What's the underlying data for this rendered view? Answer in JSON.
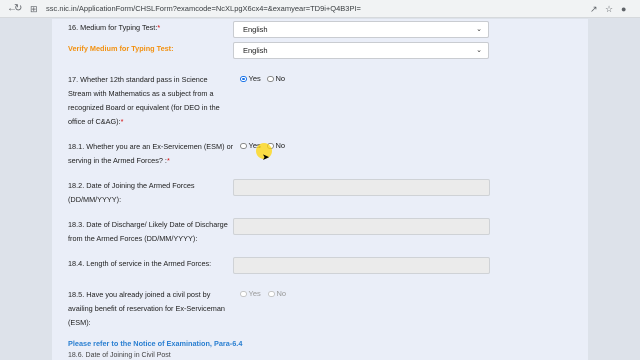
{
  "browser": {
    "url": "ssc.nic.in/ApplicationForm/CHSLForm?examcode=NcXLpgX6cx4=&examyear=TD9i+Q4B3PI=",
    "icons": [
      "back-icon",
      "reload-icon",
      "site-info-icon",
      "share-icon",
      "bookmark-star-icon",
      "profile-icon"
    ]
  },
  "form": {
    "q16": {
      "label": "16. Medium for Typing Test:",
      "required": "*",
      "value": "English"
    },
    "verify": {
      "label": "Verify Medium for Typing Test:",
      "value": "English"
    },
    "q17": {
      "lines": [
        "17. Whether 12th standard pass in Science",
        "Stream with Mathematics as a subject from a",
        "recognized Board or equivalent (for DEO in the",
        "office of C&AG):"
      ],
      "required": "*",
      "yes": "Yes",
      "no": "No",
      "selected": "Yes"
    },
    "q18_1": {
      "lines": [
        "18.1. Whether you are an Ex-Servicemen (ESM) or",
        "serving in the Armed Forces? :"
      ],
      "required": "*",
      "yes": "Yes",
      "no": "No",
      "selected": ""
    },
    "q18_2": {
      "lines": [
        "18.2. Date of Joining the Armed Forces",
        "(DD/MM/YYYY):"
      ],
      "value": ""
    },
    "q18_3": {
      "lines": [
        "18.3. Date of Discharge/ Likely Date of Discharge",
        "from the Armed Forces (DD/MM/YYYY):"
      ],
      "value": ""
    },
    "q18_4": {
      "label": "18.4. Length of service in the Armed Forces:",
      "value": ""
    },
    "q18_5": {
      "lines": [
        "18.5. Have you already joined a civil post by",
        "availing benefit of reservation for Ex-Serviceman",
        "(ESM):"
      ],
      "yes": "Yes",
      "no": "No"
    },
    "notice": "Please refer to the Notice of Examination, Para-6.4",
    "q18_6_partial": "18.6. Date of Joining in Civil Post"
  }
}
